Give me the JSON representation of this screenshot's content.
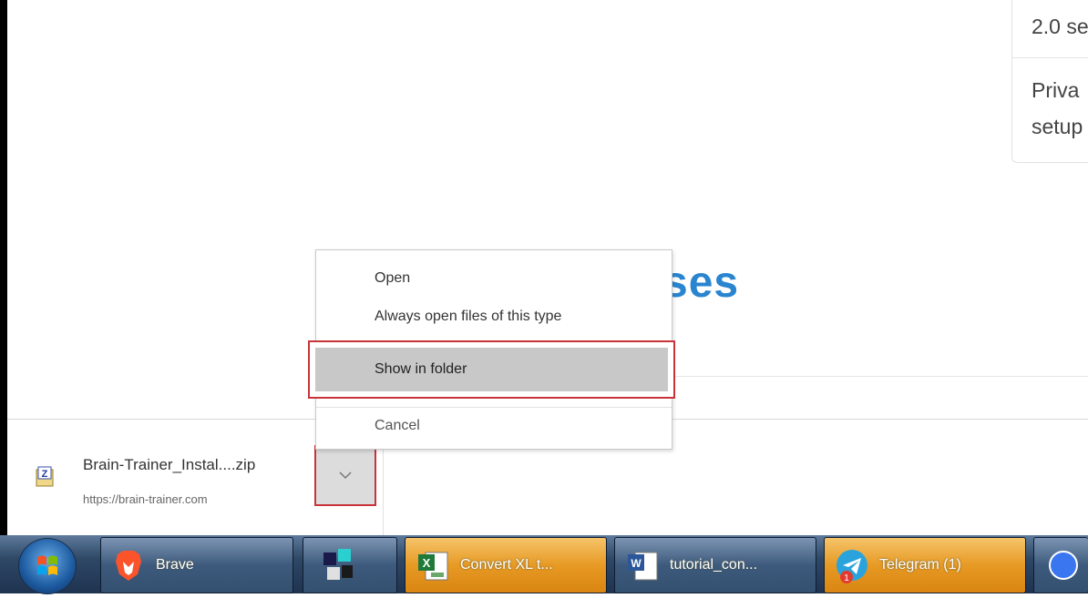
{
  "page": {
    "right_card": {
      "line1": "2.0 se",
      "line2": "Priva",
      "line3": "setup"
    },
    "heading_fragment": "ses"
  },
  "download_bar": {
    "file_name": "Brain-Trainer_Instal....zip",
    "file_url": "https://brain-trainer.com"
  },
  "context_menu": {
    "items": [
      "Open",
      "Always open files of this type",
      "Show in folder",
      "Cancel"
    ],
    "highlighted": "Show in folder"
  },
  "taskbar": {
    "buttons": [
      {
        "label": "Brave",
        "icon": "brave-lion-icon"
      },
      {
        "label": "",
        "icon": "mfc-cube-icon"
      },
      {
        "label": "Convert XL t...",
        "icon": "excel-icon"
      },
      {
        "label": "tutorial_con...",
        "icon": "word-icon"
      },
      {
        "label": "Telegram (1)",
        "icon": "telegram-icon",
        "badge": "1"
      }
    ]
  },
  "colors": {
    "highlight_border": "#c8343a",
    "heading_blue": "#2a85d0",
    "taskbar_active": "#e79a24"
  }
}
